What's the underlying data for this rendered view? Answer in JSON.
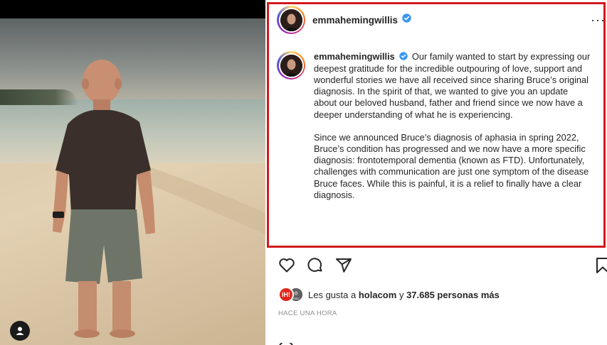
{
  "post": {
    "username": "emmahemingwillis",
    "verified_icon": "verified-badge-icon",
    "more_label": "···",
    "caption_para1": "Our family wanted to start by expressing our deepest gratitude for the incredible outpouring of love, support and wonderful stories we have all received since sharing Bruce’s original diagnosis. In the spirit of that, we wanted to give you an update about our beloved husband, father and friend since we now have a deeper understanding of what he is experiencing.",
    "caption_para2": "Since we announced Bruce’s diagnosis of aphasia in spring 2022, Bruce’s condition has progressed and we now have a more specific diagnosis: frontotemporal dementia (known as FTD). Unfortunately, challenges with communication are just one symptom of the disease Bruce faces. While this is painful, it is a relief to finally have a clear diagnosis.",
    "actions": [
      "heart-icon",
      "comment-icon",
      "share-icon",
      "bookmark-icon"
    ],
    "likes": {
      "avatar1_text": "iH!",
      "prefix": "Les gusta a",
      "user": "holacom",
      "connector": "y",
      "count_text": "37.685 personas más"
    },
    "timestamp": "HACE UNA HORA"
  },
  "colors": {
    "highlight_border": "#d0191e",
    "verified_blue": "#3897f0",
    "timestamp_gray": "#8e8e8e"
  }
}
